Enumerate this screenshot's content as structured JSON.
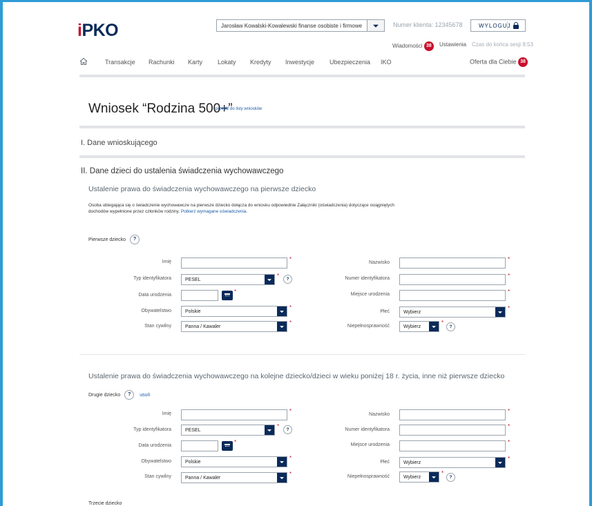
{
  "header": {
    "logo": {
      "i": "i",
      "pko": "PKO"
    },
    "user_select": {
      "value": "Jarosław Kowalski-Kowalewski finanse osobiste i firmowe"
    },
    "client_number": "Numer klienta: 12345678",
    "logout_label": "WYLOGUJ",
    "messages_label": "Wiadomości",
    "messages_count": "38",
    "settings_label": "Ustawienia",
    "session_label": "Czas do końca sesji 8:53"
  },
  "nav": {
    "items": [
      "Transakcje",
      "Rachunki",
      "Karty",
      "Lokaty",
      "Kredyty",
      "Inwestycje",
      "Ubezpieczenia",
      "IKO"
    ],
    "offer_label": "Oferta dla Ciebie",
    "offer_count": "38"
  },
  "page": {
    "title": "Wniosek “Rodzina 500+”",
    "back_link": "przejdź do listy wniosków",
    "section1": "I. Dane wnioskującego",
    "section2": "II. Dane dzieci do ustalenia świadczenia wychowawczego",
    "first_child_heading": "Ustalenie prawa do świadczenia wychowawczego na pierwsze dziecko",
    "info_text": "Osoba ubiegająca się o świadczenie wychowawcze na pierwsze dziecko dołącza do wniosku odpowiednie Załączniki (oświadczenia) dotyczące osiągniętych dochodów wypełnione przez członków rodziny.",
    "info_link": "Pobierz wymagane oświadczenia.",
    "next_children_heading": "Ustalenie prawa do świadczenia wychowawczego na kolejne dziecko/dzieci w wieku poniżej 18 r. życia, inne niż pierwsze dziecko",
    "remove_link": "usuń",
    "third_child_label": "Trzecie dziecko"
  },
  "children": [
    {
      "label": "Pierwsze dziecko",
      "fields": {
        "first_name_label": "Imię",
        "first_name_value": "",
        "id_type_label": "Typ identyfikatora",
        "id_type_value": "PESEL",
        "birth_date_label": "Data urodzenia",
        "birth_date_value": "",
        "citizenship_label": "Obywatelstwo",
        "citizenship_value": "Polskie",
        "marital_label": "Stan cywilny",
        "marital_value": "Panna / Kawaler",
        "last_name_label": "Nazwisko",
        "last_name_value": "",
        "id_number_label": "Numer identyfikatora",
        "id_number_value": "",
        "birth_place_label": "Miejsce urodzenia",
        "birth_place_value": "",
        "sex_label": "Płeć",
        "sex_value": "Wybierz",
        "disability_label": "Niepełnosprawność",
        "disability_value": "Wybierz"
      }
    },
    {
      "label": "Drugie dziecko",
      "fields": {
        "first_name_label": "Imię",
        "first_name_value": "",
        "id_type_label": "Typ identyfikatora",
        "id_type_value": "PESEL",
        "birth_date_label": "Data urodzenia",
        "birth_date_value": "",
        "citizenship_label": "Obywatelstwo",
        "citizenship_value": "Polskie",
        "marital_label": "Stan cywilny",
        "marital_value": "Panna / Kawaler",
        "last_name_label": "Nazwisko",
        "last_name_value": "",
        "id_number_label": "Numer identyfikatora",
        "id_number_value": "",
        "birth_place_label": "Miejsce urodzenia",
        "birth_place_value": "",
        "sex_label": "Płeć",
        "sex_value": "Wybierz",
        "disability_label": "Niepełnosprawność",
        "disability_value": "Wybierz"
      }
    }
  ],
  "colors": {
    "brand_navy": "#0a2a5a",
    "brand_red": "#c8102e",
    "link_blue": "#1a5aa6",
    "frame_blue": "#2f9bd6"
  }
}
